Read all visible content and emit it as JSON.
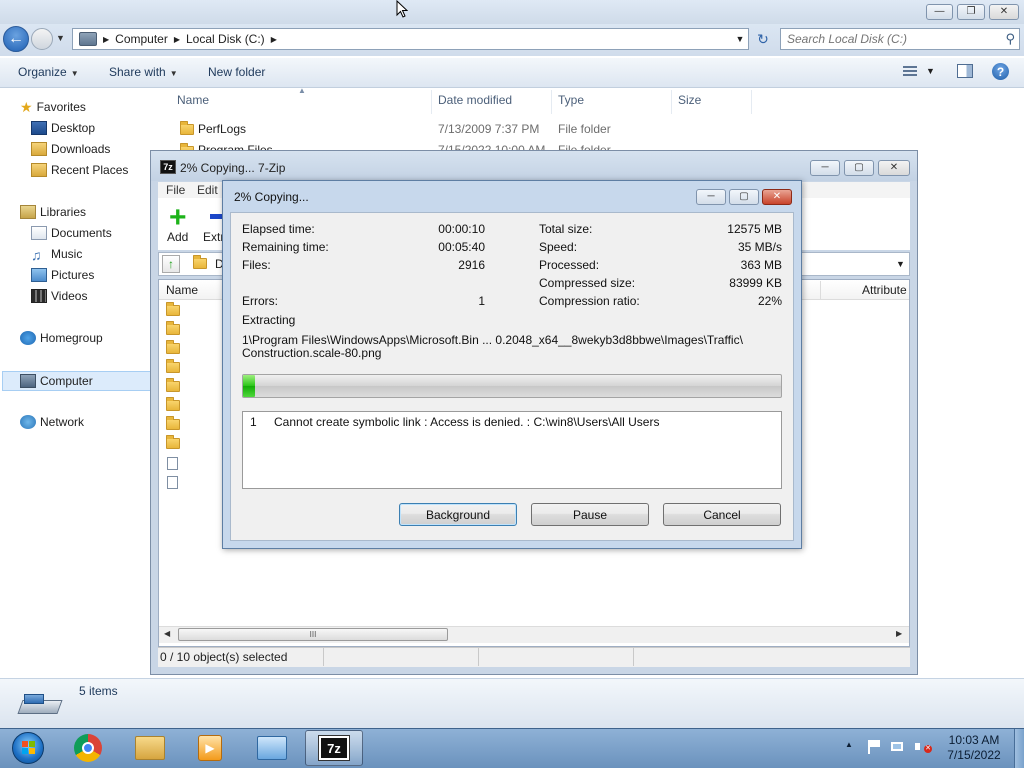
{
  "explorer": {
    "window_buttons": {
      "minimize": "—",
      "maximize": "❐",
      "close": "✕"
    },
    "breadcrumb": [
      "Computer",
      "Local Disk (C:)"
    ],
    "search_placeholder": "Search Local Disk (C:)",
    "toolbar": {
      "organize": "Organize",
      "share_with": "Share with",
      "new_folder": "New folder"
    },
    "nav": {
      "favorites": "Favorites",
      "favorites_items": [
        "Desktop",
        "Downloads",
        "Recent Places"
      ],
      "libraries": "Libraries",
      "libraries_items": [
        "Documents",
        "Music",
        "Pictures",
        "Videos"
      ],
      "homegroup": "Homegroup",
      "computer": "Computer",
      "network": "Network"
    },
    "columns": [
      "Name",
      "Date modified",
      "Type",
      "Size"
    ],
    "rows": [
      {
        "name": "PerfLogs",
        "date": "7/13/2009 7:37 PM",
        "type": "File folder"
      },
      {
        "name": "Program Files",
        "date": "7/15/2022 10:00 AM",
        "type": "File folder"
      }
    ],
    "status_items": "5 items"
  },
  "zip_main": {
    "title": "2% Copying... 7-Zip",
    "menu": [
      "File",
      "Edit"
    ],
    "toolbar": {
      "add": "Add",
      "extract": "Extr"
    },
    "address_fragment": "D",
    "columns": {
      "name": "Name",
      "attributes": "Attribute"
    },
    "status": "0 / 10 object(s) selected",
    "scroll_thumb": "III"
  },
  "dialog": {
    "title": "2% Copying...",
    "elapsed_label": "Elapsed time:",
    "elapsed_value": "00:00:10",
    "remaining_label": "Remaining time:",
    "remaining_value": "00:05:40",
    "files_label": "Files:",
    "files_value": "2916",
    "errors_label": "Errors:",
    "errors_value": "1",
    "total_size_label": "Total size:",
    "total_size_value": "12575 MB",
    "speed_label": "Speed:",
    "speed_value": "35 MB/s",
    "processed_label": "Processed:",
    "processed_value": "363 MB",
    "compressed_size_label": "Compressed size:",
    "compressed_size_value": "83999 KB",
    "compression_ratio_label": "Compression ratio:",
    "compression_ratio_value": "22%",
    "operation": "Extracting",
    "current_file_line1": "1\\Program Files\\WindowsApps\\Microsoft.Bin ... 0.2048_x64__8wekyb3d8bbwe\\Images\\Traffic\\",
    "current_file_line2": "Construction.scale-80.png",
    "progress_fraction": 0.02,
    "message_num": "1",
    "message_text": "Cannot create symbolic link : Access is denied. : C:\\win8\\Users\\All Users",
    "buttons": {
      "background": "Background",
      "pause": "Pause",
      "cancel": "Cancel"
    }
  },
  "taskbar": {
    "time": "10:03 AM",
    "date": "7/15/2022",
    "zip_label": "7z"
  }
}
